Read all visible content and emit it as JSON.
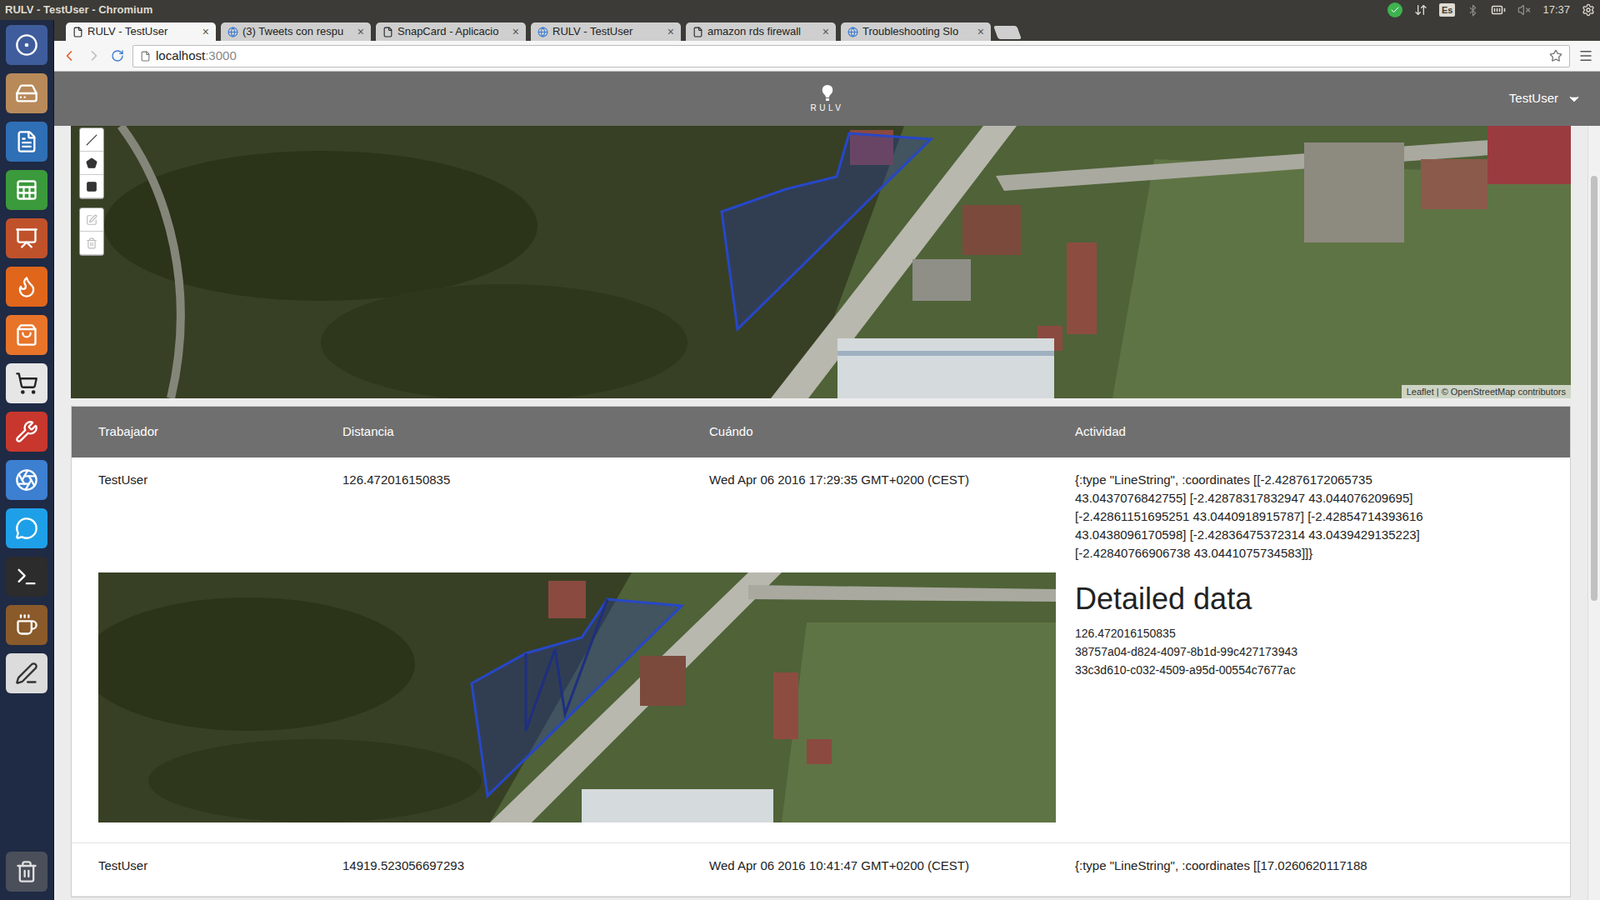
{
  "window": {
    "title": "RULV - TestUser - Chromium"
  },
  "top_panel": {
    "keyboard": "Es",
    "time": "17:37"
  },
  "browser": {
    "tabs": [
      {
        "label": "RULV - TestUser",
        "selected": true
      },
      {
        "label": "(3) Tweets con respu",
        "selected": false
      },
      {
        "label": "SnapCard - Aplicacio",
        "selected": false
      },
      {
        "label": "RULV - TestUser",
        "selected": false
      },
      {
        "label": "amazon rds firewall",
        "selected": false
      },
      {
        "label": "Troubleshooting Slo",
        "selected": false
      }
    ],
    "tab_close": "×",
    "address": {
      "host": "localhost",
      "port": ":3000"
    }
  },
  "app": {
    "logo": "RULV",
    "user": "TestUser"
  },
  "map": {
    "attribution": "Leaflet | © OpenStreetMap contributors",
    "tools": [
      {
        "kind": "polyline",
        "group": "draw",
        "disabled": false
      },
      {
        "kind": "polygon",
        "group": "draw",
        "disabled": false
      },
      {
        "kind": "rectangle",
        "group": "draw",
        "disabled": false
      },
      {
        "kind": "edit",
        "group": "edit",
        "disabled": true
      },
      {
        "kind": "delete",
        "group": "edit",
        "disabled": true
      }
    ]
  },
  "table": {
    "columns": [
      "Trabajador",
      "Distancia",
      "Cuándo",
      "Actividad"
    ],
    "rows": [
      {
        "worker": "TestUser",
        "distance": "126.472016150835",
        "when": "Wed Apr 06 2016 17:29:35 GMT+0200 (CEST)",
        "activity": "{:type \"LineString\", :coordinates [[-2.42876172065735 43.0437076842755] [-2.42878317832947 43.044076209695] [-2.42861151695251 43.0440918915787] [-2.42854714393616 43.0438096170598] [-2.42836475372314 43.0439429135223] [-2.42840766906738 43.0441075734583]]}",
        "expanded": true,
        "detail": {
          "heading": "Detailed data",
          "lines": [
            "126.472016150835",
            "38757a04-d824-4097-8b1d-99c427173943",
            "33c3d610-c032-4509-a95d-00554c7677ac"
          ]
        }
      },
      {
        "worker": "TestUser",
        "distance": "14919.523056697293",
        "when": "Wed Apr 06 2016 10:41:47 GMT+0200 (CEST)",
        "activity": "{:type \"LineString\", :coordinates [[17.0260620117188",
        "expanded": false,
        "detail": {
          "heading": "",
          "lines": []
        }
      }
    ]
  }
}
